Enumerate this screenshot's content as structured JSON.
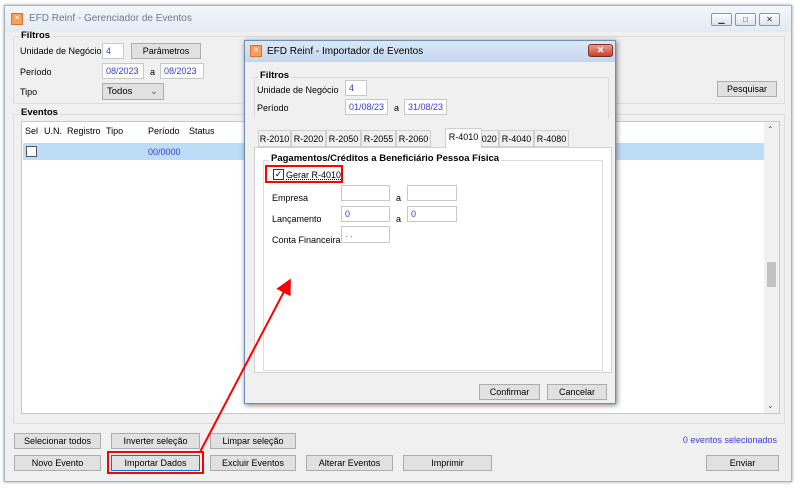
{
  "main": {
    "title": "EFD Reinf - Gerenciador de Eventos",
    "filters": {
      "legend": "Filtros",
      "unit_label": "Unidade de Negócio",
      "unit_value": "4",
      "params_button": "Parâmetros",
      "period_label": "Período",
      "period_from": "08/2023",
      "period_sep": "a",
      "period_to": "08/2023",
      "type_label": "Tipo",
      "type_value": "Todos",
      "search_button": "Pesquisar"
    },
    "events": {
      "legend": "Eventos",
      "columns": [
        "Sel",
        "U.N.",
        "Registro",
        "Tipo",
        "Período",
        "Status"
      ],
      "rows": [
        {
          "sel": "",
          "un": "",
          "registro": "",
          "tipo": "",
          "periodo": "00/0000",
          "status": ""
        }
      ]
    },
    "buttons": {
      "select_all": "Selecionar todos",
      "invert": "Inverter seleção",
      "clear": "Limpar seleção",
      "new_event": "Novo Evento",
      "import": "Importar Dados",
      "delete": "Excluir Eventos",
      "edit": "Alterar Eventos",
      "print": "Imprimir",
      "send": "Enviar"
    },
    "selected_count": "0 eventos selecionados"
  },
  "dialog": {
    "title": "EFD Reinf - Importador de Eventos",
    "filters": {
      "legend": "Filtros",
      "unit_label": "Unidade de Negócio",
      "unit_value": "4",
      "period_label": "Período",
      "period_from": "01/08/23",
      "period_sep": "a",
      "period_to": "31/08/23"
    },
    "tabs": [
      "R-2010",
      "R-2020",
      "R-2050",
      "R-2055",
      "R-2060",
      "R-4010",
      "R-4020",
      "R-4040",
      "R-4080"
    ],
    "active_tab": "R-4010",
    "panel": {
      "legend": "Pagamentos/Créditos a Beneficiário Pessoa Física",
      "generate_label": "Gerar R-4010",
      "generate_checked": true,
      "company_label": "Empresa",
      "company_from": "",
      "company_to": "",
      "sep": "a",
      "entry_label": "Lançamento",
      "entry_from": "0",
      "entry_to": "0",
      "account_label": "Conta Financeira",
      "account_value": ". ."
    },
    "confirm": "Confirmar",
    "cancel": "Cancelar"
  },
  "colors": {
    "highlight": "#ff0000",
    "selected_row": "#bcdcf7",
    "link_blue": "#3a3ad0"
  }
}
